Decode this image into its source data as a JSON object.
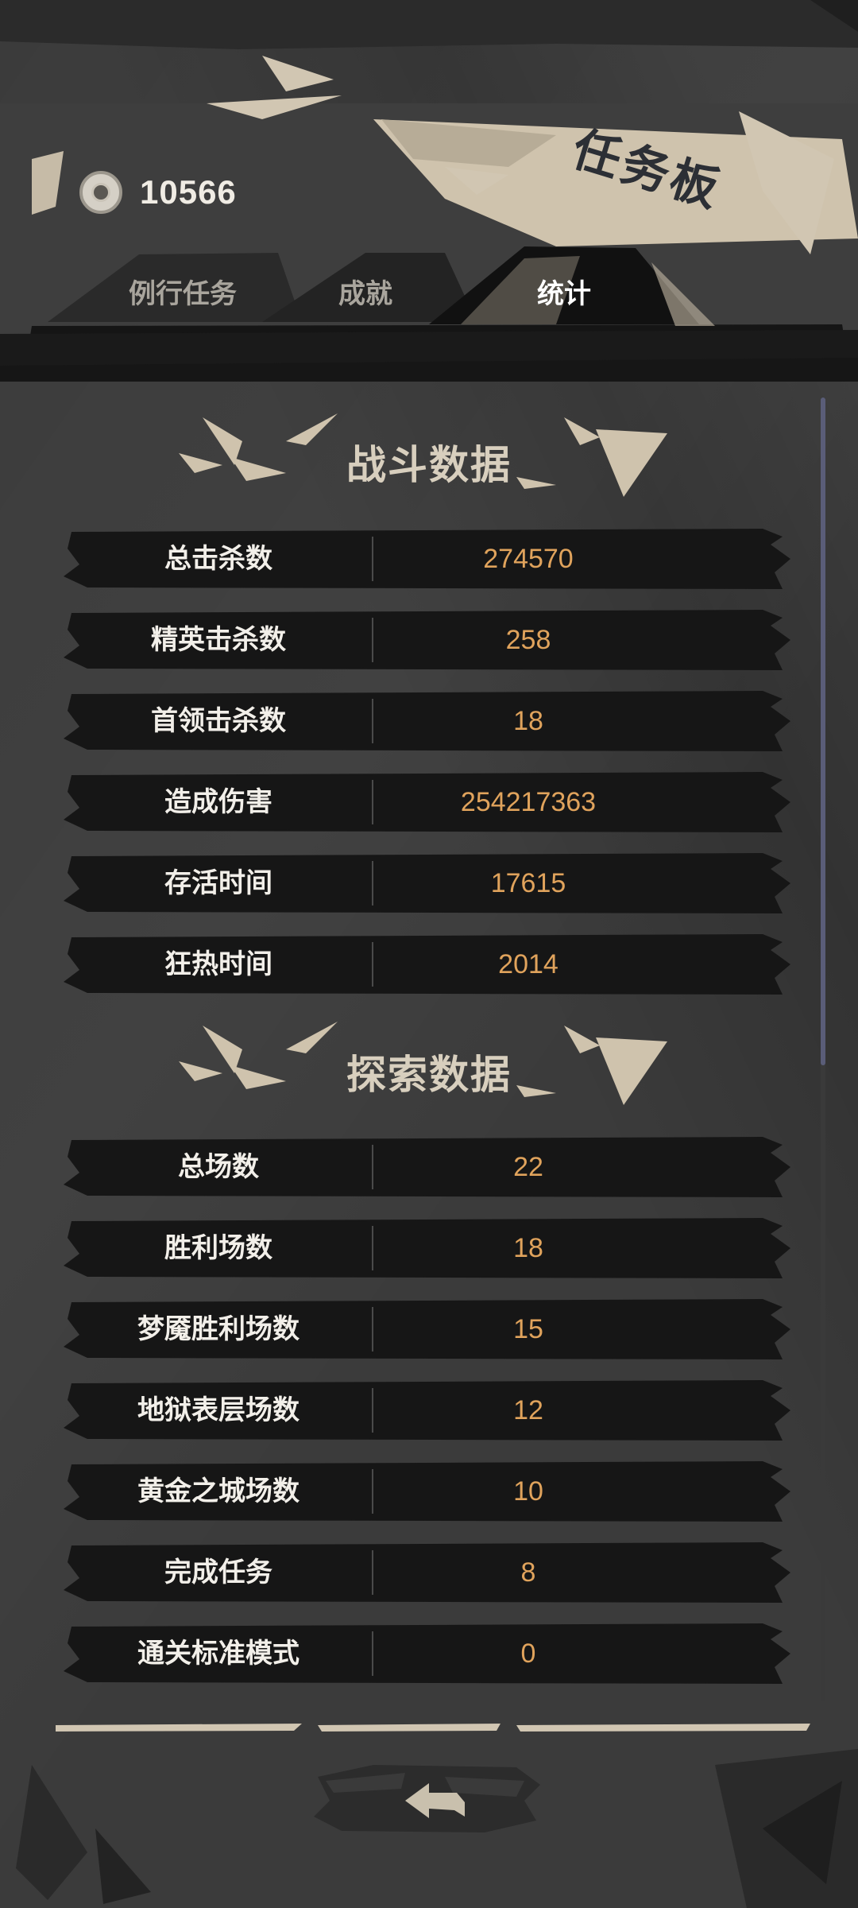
{
  "header": {
    "currency_value": "10566",
    "board_title": "任务板",
    "tabs": [
      {
        "label": "例行任务",
        "active": false
      },
      {
        "label": "成就",
        "active": false
      },
      {
        "label": "统计",
        "active": true
      }
    ]
  },
  "sections": [
    {
      "title": "战斗数据",
      "rows": [
        {
          "label": "总击杀数",
          "value": "274570"
        },
        {
          "label": "精英击杀数",
          "value": "258"
        },
        {
          "label": "首领击杀数",
          "value": "18"
        },
        {
          "label": "造成伤害",
          "value": "254217363"
        },
        {
          "label": "存活时间",
          "value": "17615"
        },
        {
          "label": "狂热时间",
          "value": "2014"
        }
      ]
    },
    {
      "title": "探索数据",
      "rows": [
        {
          "label": "总场数",
          "value": "22"
        },
        {
          "label": "胜利场数",
          "value": "18"
        },
        {
          "label": "梦魇胜利场数",
          "value": "15"
        },
        {
          "label": "地狱表层场数",
          "value": "12"
        },
        {
          "label": "黄金之城场数",
          "value": "10"
        },
        {
          "label": "完成任务",
          "value": "8"
        },
        {
          "label": "通关标准模式",
          "value": "0"
        }
      ]
    }
  ],
  "colors": {
    "background": "#3b3b3b",
    "accent_parchment": "#d8cfbe",
    "value_orange": "#e0a35c",
    "row_black": "#161616"
  },
  "icons": {
    "currency": "coin-icon",
    "back": "back-arrow-icon"
  }
}
